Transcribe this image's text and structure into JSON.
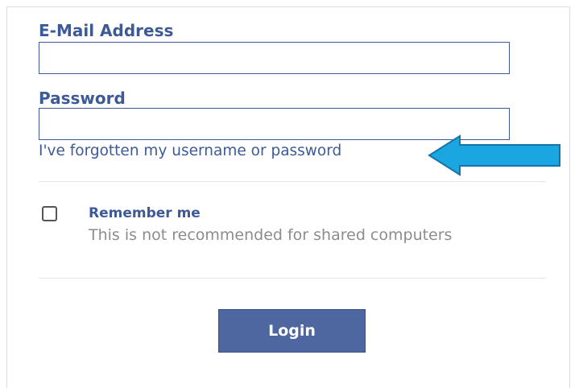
{
  "form": {
    "email_label": "E-Mail Address",
    "email_value": "",
    "password_label": "Password",
    "password_value": "",
    "forgot_link": "I've forgotten my username or password",
    "remember_label": "Remember me",
    "remember_hint": "This is not recommended for shared computers",
    "remember_checked": false,
    "login_button": "Login"
  },
  "annotation": {
    "arrow_icon": "left-arrow-icon",
    "arrow_color": "#1aa6e0"
  },
  "colors": {
    "label": "#3d5a98",
    "button": "#4e67a0",
    "hint": "#8c8c8c"
  }
}
